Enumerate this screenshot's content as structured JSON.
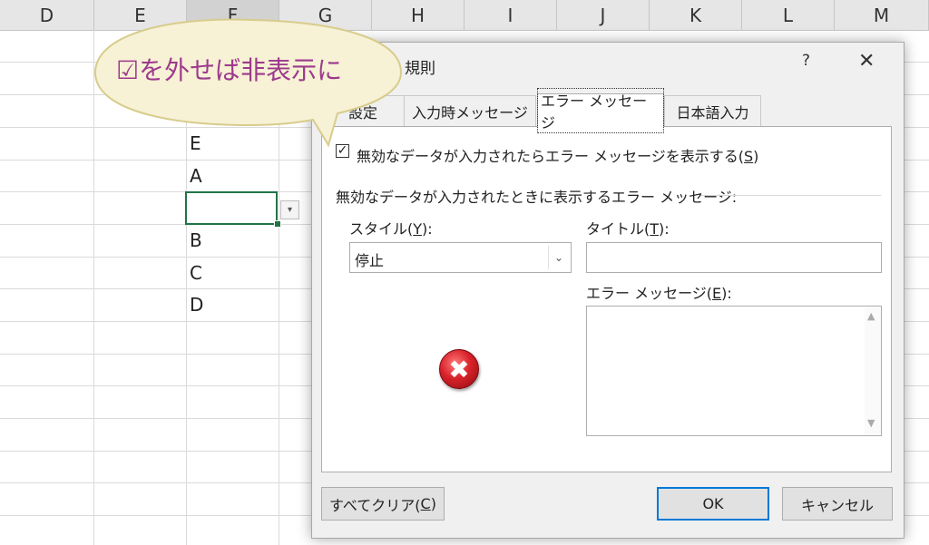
{
  "sheet": {
    "columns": [
      "D",
      "E",
      "F",
      "G",
      "H",
      "I",
      "J",
      "K",
      "L",
      "M"
    ],
    "cells": [
      "E",
      "A",
      "",
      "B",
      "C",
      "D"
    ],
    "dropdown_glyph": "▾"
  },
  "callout": {
    "text": "☑を外せば非表示に",
    "fill": "#f7f1d5",
    "stroke": "#d8cc8c",
    "text_color": "#9c3a8c"
  },
  "dialog": {
    "title": "規則",
    "help": "?",
    "close": "✕",
    "tabs": [
      "設定",
      "入力時メッセージ",
      "エラー メッセージ",
      "日本語入力"
    ],
    "active_tab": "エラー メッセージ",
    "show_error": {
      "checked": true,
      "mark": "✓",
      "label_pre": "無効なデータが入力されたらエラー メッセージを表示する(",
      "label_key": "S",
      "label_post": ")"
    },
    "group_label": "無効なデータが入力されたときに表示するエラー メッセージ:",
    "style": {
      "label_pre": "スタイル(",
      "key": "Y",
      "label_post": "):",
      "value": "停止",
      "arrow": "⌄"
    },
    "title_field": {
      "label_pre": "タイトル(",
      "key": "T",
      "label_post": "):",
      "value": ""
    },
    "message_field": {
      "label_pre": "エラー メッセージ(",
      "key": "E",
      "label_post": "):",
      "value": ""
    },
    "error_icon_glyph": "✖",
    "buttons": {
      "clear_pre": "すべてクリア(",
      "clear_key": "C",
      "clear_post": ")",
      "ok": "OK",
      "cancel": "キャンセル"
    }
  }
}
